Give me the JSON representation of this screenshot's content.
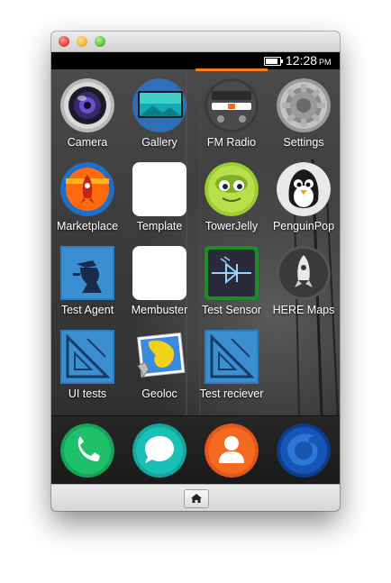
{
  "status_bar": {
    "time": "12:28",
    "ampm": "PM"
  },
  "apps": [
    {
      "label": "Camera",
      "icon": "camera-icon"
    },
    {
      "label": "Gallery",
      "icon": "gallery-icon"
    },
    {
      "label": "FM Radio",
      "icon": "radio-icon"
    },
    {
      "label": "Settings",
      "icon": "gear-icon"
    },
    {
      "label": "Marketplace",
      "icon": "marketplace-rocket-icon"
    },
    {
      "label": "Template",
      "icon": "blank-app-icon"
    },
    {
      "label": "TowerJelly",
      "icon": "towerjelly-icon"
    },
    {
      "label": "PenguinPop",
      "icon": "penguin-icon"
    },
    {
      "label": "Test Agent",
      "icon": "sherlock-silhouette-icon"
    },
    {
      "label": "Membuster",
      "icon": "blank-app-icon"
    },
    {
      "label": "Test Sensor",
      "icon": "sensor-circuit-icon"
    },
    {
      "label": "HERE Maps",
      "icon": "here-maps-icon"
    },
    {
      "label": "UI tests",
      "icon": "set-square-icon"
    },
    {
      "label": "Geoloc",
      "icon": "geoloc-map-icon"
    },
    {
      "label": "Test reciever",
      "icon": "set-square-icon"
    }
  ],
  "dock": [
    {
      "icon": "phone-icon"
    },
    {
      "icon": "messages-icon"
    },
    {
      "icon": "contacts-icon"
    },
    {
      "icon": "firefox-browser-icon"
    }
  ],
  "navbar": {
    "icon": "home-icon"
  }
}
